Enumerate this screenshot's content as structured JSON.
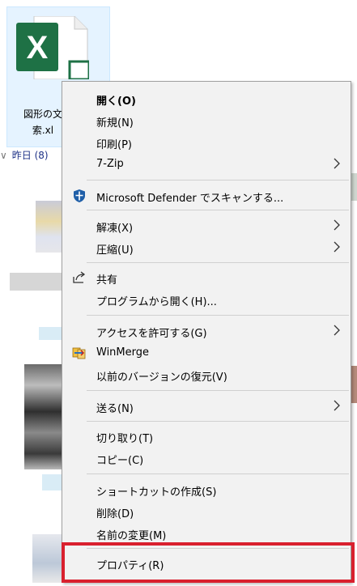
{
  "file": {
    "label_line1": "図形の文",
    "label_line2": "索.xl"
  },
  "group": {
    "header": "昨日 (8)"
  },
  "menu": {
    "items": [
      {
        "label": "開く(O)"
      },
      {
        "label": "新規(N)"
      },
      {
        "label": "印刷(P)"
      },
      {
        "label": "7-Zip"
      },
      {
        "label": "Microsoft Defender でスキャンする..."
      },
      {
        "label": "解凍(X)"
      },
      {
        "label": "圧縮(U)"
      },
      {
        "label": "共有"
      },
      {
        "label": "プログラムから開く(H)..."
      },
      {
        "label": "アクセスを許可する(G)"
      },
      {
        "label": "WinMerge"
      },
      {
        "label": "以前のバージョンの復元(V)"
      },
      {
        "label": "送る(N)"
      },
      {
        "label": "切り取り(T)"
      },
      {
        "label": "コピー(C)"
      },
      {
        "label": "ショートカットの作成(S)"
      },
      {
        "label": "削除(D)"
      },
      {
        "label": "名前の変更(M)"
      },
      {
        "label": "プロパティ(R)"
      }
    ]
  },
  "colors": {
    "excel_green": "#1e7145",
    "highlight_red": "#d9202e",
    "menu_bg": "#f2f2f2"
  }
}
